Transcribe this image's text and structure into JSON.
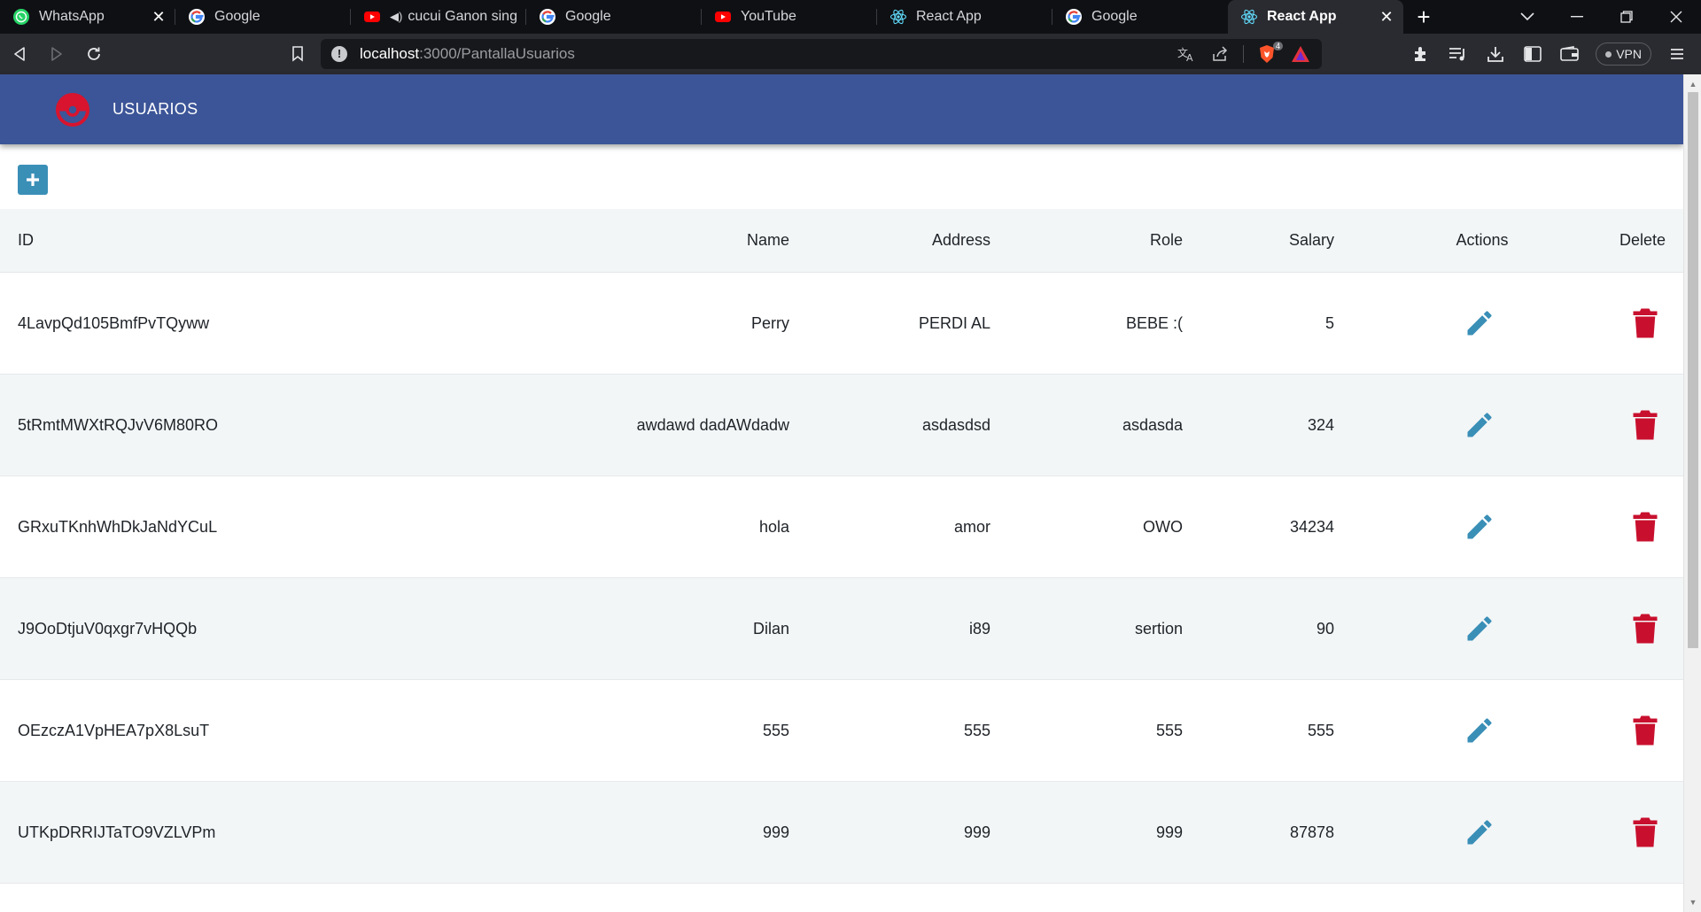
{
  "browser": {
    "tabs": [
      {
        "title": "WhatsApp",
        "icon": "whatsapp-icon",
        "active": false,
        "has_close": true
      },
      {
        "title": "Google",
        "icon": "google-icon",
        "active": false
      },
      {
        "title": "cucui Ganon singin",
        "icon": "youtube-icon",
        "active": false,
        "audio": true
      },
      {
        "title": "Google",
        "icon": "google-icon",
        "active": false
      },
      {
        "title": "YouTube",
        "icon": "youtube-icon",
        "active": false
      },
      {
        "title": "React App",
        "icon": "react-icon",
        "active": false
      },
      {
        "title": "Google",
        "icon": "google-icon",
        "active": false
      },
      {
        "title": "React App",
        "icon": "react-icon",
        "active": true,
        "has_close": true
      }
    ],
    "url_host": "localhost",
    "url_path": ":3000/PantallaUsuarios",
    "shield_count": "4",
    "vpn_label": "VPN"
  },
  "app": {
    "title": "USUARIOS",
    "colors": {
      "header": "#3c5598",
      "add": "#3a8fb7",
      "edit": "#3a8fb7",
      "delete": "#c8102e",
      "logo": "#d8142e"
    }
  },
  "table": {
    "columns": {
      "id": "ID",
      "name": "Name",
      "address": "Address",
      "role": "Role",
      "salary": "Salary",
      "actions": "Actions",
      "delete": "Delete"
    },
    "rows": [
      {
        "id": "4LavpQd105BmfPvTQyww",
        "name": "Perry",
        "address": "PERDI AL",
        "role": "BEBE :(",
        "salary": "5"
      },
      {
        "id": "5tRmtMWXtRQJvV6M80RO",
        "name": "awdawd dadAWdadw",
        "address": "asdasdsd",
        "role": "asdasda",
        "salary": "324"
      },
      {
        "id": "GRxuTKnhWhDkJaNdYCuL",
        "name": "hola",
        "address": "amor",
        "role": "OWO",
        "salary": "34234"
      },
      {
        "id": "J9OoDtjuV0qxgr7vHQQb",
        "name": "Dilan",
        "address": "i89",
        "role": "sertion",
        "salary": "90"
      },
      {
        "id": "OEzczA1VpHEA7pX8LsuT",
        "name": "555",
        "address": "555",
        "role": "555",
        "salary": "555"
      },
      {
        "id": "UTKpDRRIJTaTO9VZLVPm",
        "name": "999",
        "address": "999",
        "role": "999",
        "salary": "87878"
      }
    ]
  }
}
